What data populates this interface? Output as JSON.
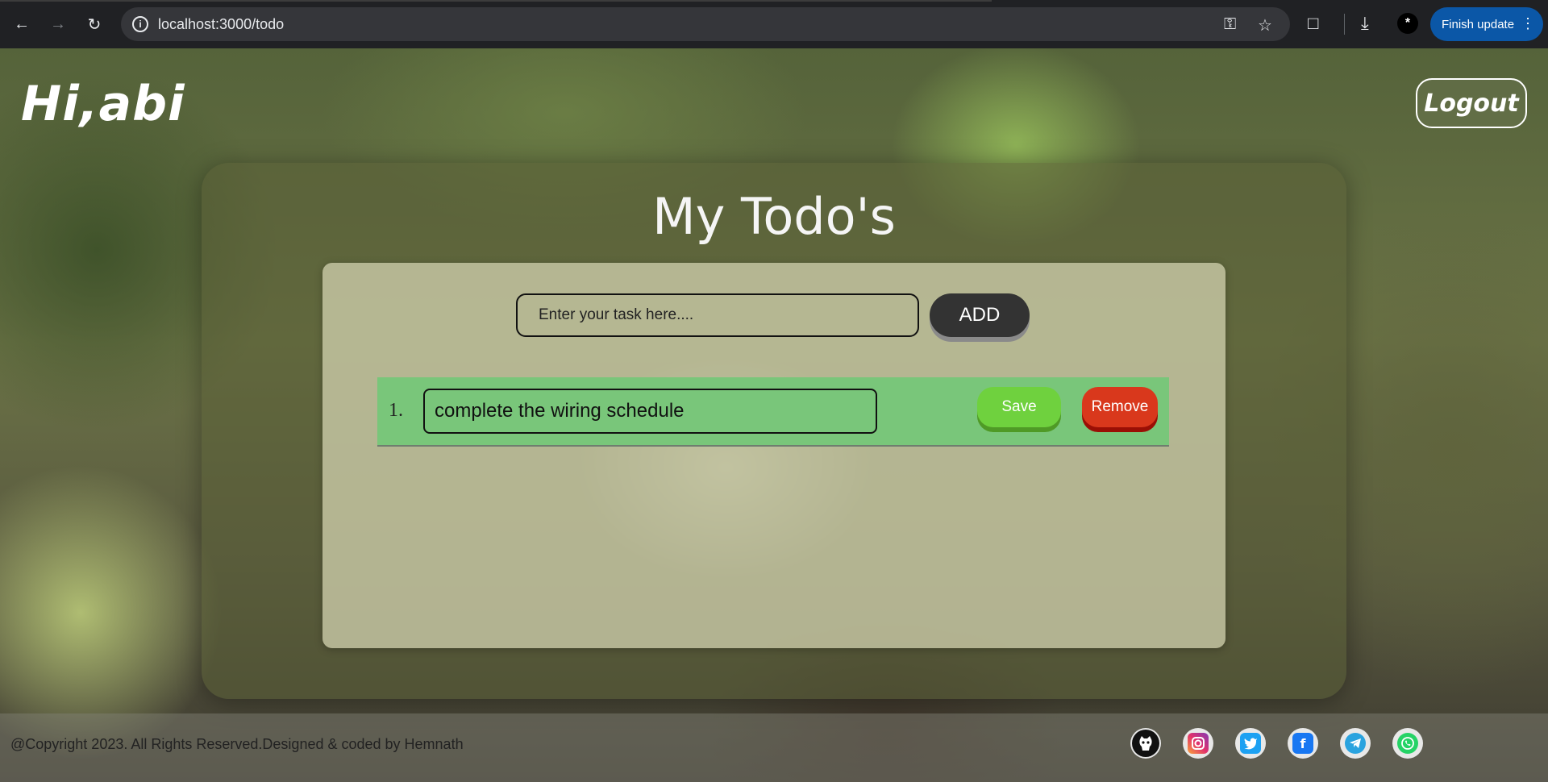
{
  "browser": {
    "url": "localhost:3000/todo",
    "update_label": "Finish update",
    "profile_initial": "*",
    "icons": [
      "back-icon",
      "forward-icon",
      "reload-icon",
      "info-icon",
      "key-icon",
      "star-icon",
      "extensions-icon",
      "download-icon",
      "kebab-icon"
    ]
  },
  "header": {
    "greeting": "Hi,abi",
    "logout_label": "Logout"
  },
  "todo": {
    "title": "My Todo's",
    "input_placeholder": "Enter your task here....",
    "add_label": "ADD",
    "items": [
      {
        "number": "1.",
        "text": "complete the wiring schedule",
        "save_label": "Save",
        "remove_label": "Remove"
      }
    ]
  },
  "footer": {
    "copyright": "@Copyright 2023. All Rights Reserved.Designed & coded by Hemnath",
    "social_icons": [
      "github-icon",
      "instagram-icon",
      "twitter-icon",
      "facebook-icon",
      "telegram-icon",
      "whatsapp-icon"
    ]
  },
  "colors": {
    "todo_row": "#79c67a",
    "save_button": "#6fd13e",
    "remove_button": "#d9381c",
    "add_button": "#333333",
    "update_button": "#0b57a7"
  }
}
